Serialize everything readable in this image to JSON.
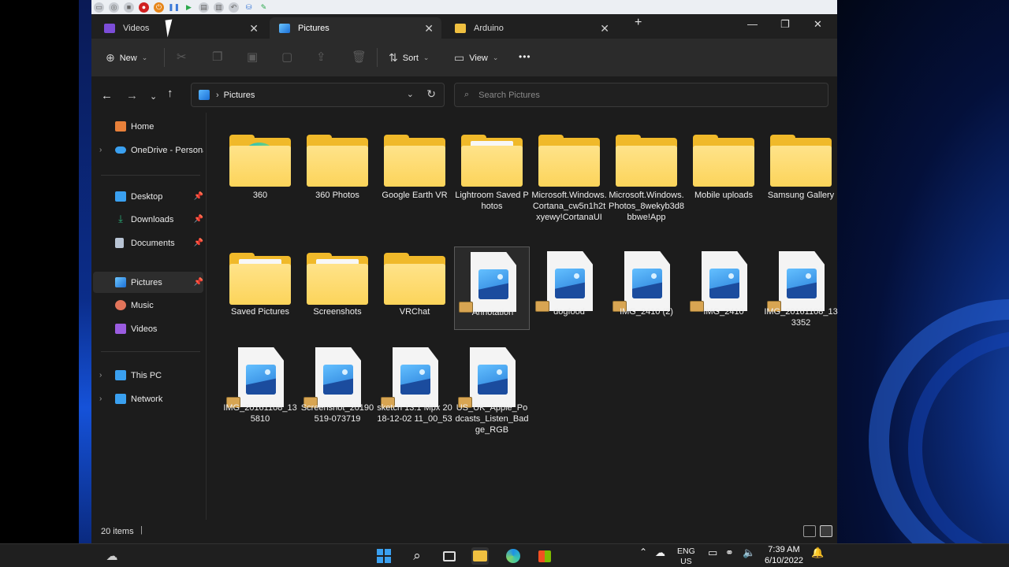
{
  "tabs": [
    {
      "label": "Videos",
      "icon": "videos-icon"
    },
    {
      "label": "Pictures",
      "icon": "pictures-icon"
    },
    {
      "label": "Arduino",
      "icon": "folder-icon"
    }
  ],
  "new_tab_label": "+",
  "window_controls": {
    "minimize": "—",
    "maximize": "❐",
    "close": "✕"
  },
  "commandbar": {
    "new_label": "New",
    "sort_label": "Sort",
    "view_label": "View",
    "more_label": "•••"
  },
  "address": {
    "path": "Pictures"
  },
  "search": {
    "placeholder": "Search Pictures"
  },
  "sidebar": {
    "items": [
      {
        "label": "Home",
        "icon": "home-icon",
        "color": "#e8803a"
      },
      {
        "label": "OneDrive - Personal",
        "icon": "onedrive-icon",
        "color": "#3aa0f0"
      },
      {
        "label": "Desktop",
        "icon": "desktop-icon",
        "color": "#3aa0f0"
      },
      {
        "label": "Downloads",
        "icon": "download-icon",
        "color": "#2ab07a"
      },
      {
        "label": "Documents",
        "icon": "document-icon",
        "color": "#b8c4d4"
      },
      {
        "label": "Pictures",
        "icon": "pictures-icon",
        "color": "#3a8fe8"
      },
      {
        "label": "Music",
        "icon": "music-icon",
        "color": "#e2745a"
      },
      {
        "label": "Videos",
        "icon": "videos-icon",
        "color": "#9a5ce0"
      },
      {
        "label": "This PC",
        "icon": "computer-icon",
        "color": "#3aa0f0"
      },
      {
        "label": "Network",
        "icon": "network-icon",
        "color": "#3aa0f0"
      }
    ]
  },
  "items": [
    {
      "name": "360",
      "kind": "folder",
      "decor": "edge"
    },
    {
      "name": "360 Photos",
      "kind": "folder",
      "decor": "none"
    },
    {
      "name": "Google Earth VR",
      "kind": "folder",
      "decor": "none"
    },
    {
      "name": "Lightroom Saved Photos",
      "kind": "folder",
      "decor": "paper"
    },
    {
      "name": "Microsoft.Windows.Cortana_cw5n1h2txyewy!CortanaUI",
      "kind": "folder",
      "decor": "none"
    },
    {
      "name": "Microsoft.Windows.Photos_8wekyb3d8bbwe!App",
      "kind": "folder",
      "decor": "none"
    },
    {
      "name": "Mobile uploads",
      "kind": "folder",
      "decor": "none"
    },
    {
      "name": "Samsung Gallery",
      "kind": "folder",
      "decor": "none"
    },
    {
      "name": "Saved Pictures",
      "kind": "folder",
      "decor": "paper"
    },
    {
      "name": "Screenshots",
      "kind": "folder",
      "decor": "paper"
    },
    {
      "name": "VRChat",
      "kind": "folder",
      "decor": "none"
    },
    {
      "name": "Annotation",
      "kind": "image",
      "decor": "none"
    },
    {
      "name": "dogfood",
      "kind": "image",
      "decor": "none"
    },
    {
      "name": "IMG_2410 (2)",
      "kind": "image",
      "decor": "none"
    },
    {
      "name": "IMG_2410",
      "kind": "image",
      "decor": "none"
    },
    {
      "name": "IMG_20161108_133352",
      "kind": "image",
      "decor": "none"
    },
    {
      "name": "IMG_20161108_135810",
      "kind": "image",
      "decor": "none"
    },
    {
      "name": "Screenshot_20190519-073719",
      "kind": "image",
      "decor": "none"
    },
    {
      "name": "sketch 13.1 Mpx 2018-12-02 11_00_53",
      "kind": "image",
      "decor": "none"
    },
    {
      "name": "US_UK_Apple_Podcasts_Listen_Badge_RGB",
      "kind": "image",
      "decor": "none"
    }
  ],
  "status": {
    "count": "20 items",
    "separator": "|"
  },
  "taskbar": {
    "lang_top": "ENG",
    "lang_bottom": "US",
    "time": "7:39 AM",
    "date": "6/10/2022"
  }
}
